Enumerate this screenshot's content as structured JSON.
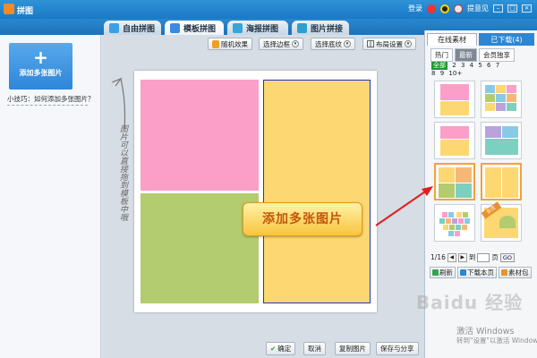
{
  "app": {
    "title": "拼图"
  },
  "titlebar": {
    "login": "登录",
    "feedback": "提意见"
  },
  "tabs": [
    {
      "label": "自由拼图"
    },
    {
      "label": "模板拼图"
    },
    {
      "label": "海报拼图"
    },
    {
      "label": "图片拼接"
    }
  ],
  "left": {
    "add_label": "添加多张图片",
    "tip": "小技巧：如何添加多张图片？"
  },
  "toolbar": {
    "random": "随机效果",
    "border": "选择边框",
    "background": "选择底纹",
    "layout": "布局设置"
  },
  "canvas": {
    "add_many": "添加多张图片",
    "annotation": "图片可以直接拖到模板中哦"
  },
  "bottom": {
    "ok": "确定",
    "cancel": "取消",
    "copy": "复制图片",
    "save": "保存与分享"
  },
  "right": {
    "tab_online": "在线素材",
    "tab_downloaded": "已下载(4)",
    "subtabs": [
      "热门",
      "最新",
      "会员独享"
    ],
    "filters": [
      "全部",
      "2",
      "3",
      "4",
      "5",
      "6",
      "7",
      "8",
      "9",
      "10+"
    ],
    "page": "1/16",
    "to": "到",
    "page_unit": "页",
    "go": "GO",
    "refresh": "刷新",
    "download_page": "下载本页",
    "material_pack": "素材包",
    "thumb_badge": "会员"
  },
  "watermark": "Baidu 经验",
  "activate": {
    "line1": "激活 Windows",
    "line2": "转到\"设置\"以激活 Windows"
  },
  "colors": {
    "pink": "#fb9ec8",
    "green": "#b2cc6f",
    "yellow": "#fdd772",
    "blue_border": "#1c37c8",
    "titlebar": "#1a79c4"
  }
}
